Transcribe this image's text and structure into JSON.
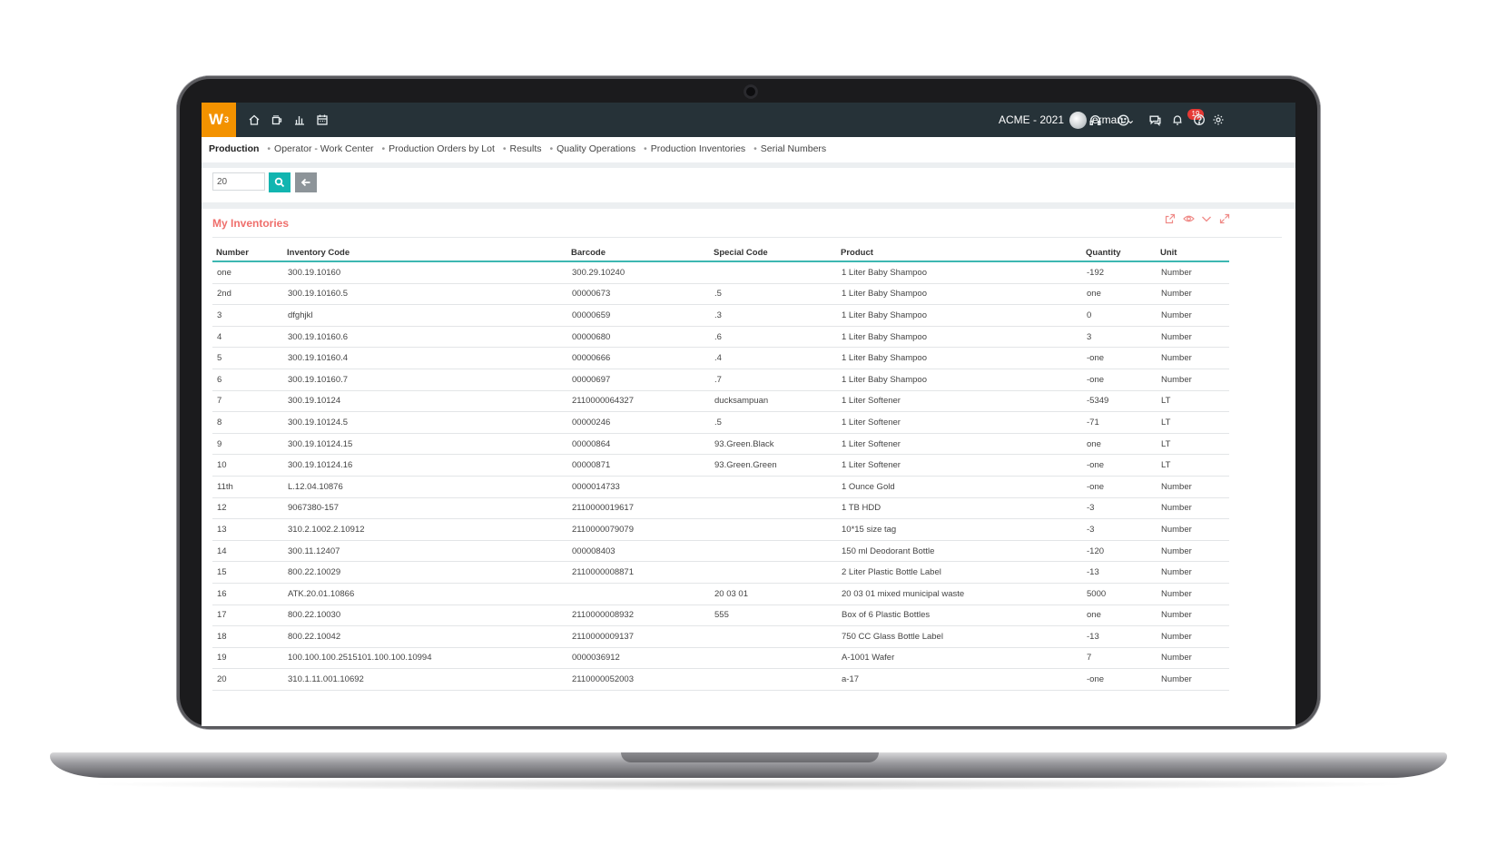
{
  "app": {
    "logo_text": "W",
    "logo_sup": "3",
    "company": "ACME - 2021",
    "user": "erman",
    "chat_badge": "19"
  },
  "breadcrumb": [
    "Production",
    "Operator - Work Center",
    "Production Orders by Lot",
    "Results",
    "Quality Operations",
    "Production Inventories",
    "Serial Numbers"
  ],
  "search": {
    "value": "20"
  },
  "panel": {
    "title": "My Inventories"
  },
  "table": {
    "columns": [
      "Number",
      "Inventory Code",
      "Barcode",
      "Special Code",
      "Product",
      "Quantity",
      "Unit"
    ],
    "rows": [
      [
        "one",
        "300.19.10160",
        "300.29.10240",
        "",
        "1 Liter Baby Shampoo",
        "-192",
        "Number"
      ],
      [
        "2nd",
        "300.19.10160.5",
        "00000673",
        ".5",
        "1 Liter Baby Shampoo",
        "one",
        "Number"
      ],
      [
        "3",
        "dfghjkl",
        "00000659",
        ".3",
        "1 Liter Baby Shampoo",
        "0",
        "Number"
      ],
      [
        "4",
        "300.19.10160.6",
        "00000680",
        ".6",
        "1 Liter Baby Shampoo",
        "3",
        "Number"
      ],
      [
        "5",
        "300.19.10160.4",
        "00000666",
        ".4",
        "1 Liter Baby Shampoo",
        "-one",
        "Number"
      ],
      [
        "6",
        "300.19.10160.7",
        "00000697",
        ".7",
        "1 Liter Baby Shampoo",
        "-one",
        "Number"
      ],
      [
        "7",
        "300.19.10124",
        "2110000064327",
        "ducksampuan",
        "1 Liter Softener",
        "-5349",
        "LT"
      ],
      [
        "8",
        "300.19.10124.5",
        "00000246",
        ".5",
        "1 Liter Softener",
        "-71",
        "LT"
      ],
      [
        "9",
        "300.19.10124.15",
        "00000864",
        "93.Green.Black",
        "1 Liter Softener",
        "one",
        "LT"
      ],
      [
        "10",
        "300.19.10124.16",
        "00000871",
        "93.Green.Green",
        "1 Liter Softener",
        "-one",
        "LT"
      ],
      [
        "11th",
        "L.12.04.10876",
        "0000014733",
        "",
        "1 Ounce Gold",
        "-one",
        "Number"
      ],
      [
        "12",
        "9067380-157",
        "2110000019617",
        "",
        "1 TB HDD",
        "-3",
        "Number"
      ],
      [
        "13",
        "310.2.1002.2.10912",
        "2110000079079",
        "",
        "10*15 size tag",
        "-3",
        "Number"
      ],
      [
        "14",
        "300.11.12407",
        "000008403",
        "",
        "150 ml Deodorant Bottle",
        "-120",
        "Number"
      ],
      [
        "15",
        "800.22.10029",
        "2110000008871",
        "",
        "2 Liter Plastic Bottle Label",
        "-13",
        "Number"
      ],
      [
        "16",
        "ATK.20.01.10866",
        "",
        "20 03 01",
        "20 03 01 mixed municipal waste",
        "5000",
        "Number"
      ],
      [
        "17",
        "800.22.10030",
        "2110000008932",
        "555",
        "Box of 6 Plastic Bottles",
        "one",
        "Number"
      ],
      [
        "18",
        "800.22.10042",
        "2110000009137",
        "",
        "750 CC Glass Bottle Label",
        "-13",
        "Number"
      ],
      [
        "19",
        "100.100.100.2515101.100.100.10994",
        "0000036912",
        "",
        "A-1001 Wafer",
        "7",
        "Number"
      ],
      [
        "20",
        "310.1.11.001.10692",
        "2110000052003",
        "",
        "a-17",
        "-one",
        "Number"
      ]
    ]
  },
  "colors": {
    "topbar": "#263238",
    "logo": "#f39200",
    "accent": "#3db7b2",
    "search_button": "#12b5b0",
    "panel_title": "#ef6f6c"
  },
  "icons": [
    "home-icon",
    "coffee-icon",
    "chart-icon",
    "calendar-icon",
    "headset-icon",
    "smiley-icon",
    "chat-icon",
    "bell-icon",
    "help-icon",
    "gear-icon",
    "search-icon",
    "arrow-left-icon",
    "export-icon",
    "eye-icon",
    "chevron-down-icon",
    "expand-icon"
  ]
}
